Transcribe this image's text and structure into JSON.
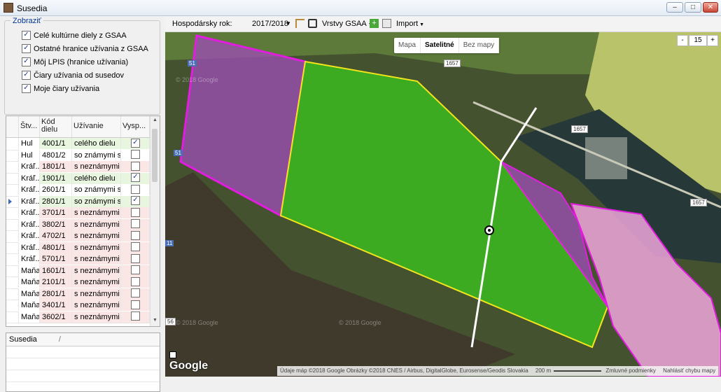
{
  "window": {
    "title": "Susedia"
  },
  "display_group": {
    "title": "Zobraziť",
    "items": [
      {
        "label": "Celé kultúrne diely z GSAA",
        "checked": true
      },
      {
        "label": "Ostatné hranice užívania z GSAA",
        "checked": true
      },
      {
        "label": "Môj LPIS (hranice užívania)",
        "checked": true
      },
      {
        "label": "Čiary užívania od susedov",
        "checked": true
      },
      {
        "label": "Moje čiary užívania",
        "checked": true
      }
    ]
  },
  "grid": {
    "headers": [
      "Štv...",
      "Kód dielu",
      "Užívanie",
      "Vysp..."
    ],
    "rows": [
      {
        "stv": "Hul",
        "kod": "4001/1",
        "uzivanie": "celého dielu",
        "checked": true,
        "tint": "green"
      },
      {
        "stv": "Hul",
        "kod": "4801/2",
        "uzivanie": "so známymi s...",
        "checked": false,
        "tint": "none"
      },
      {
        "stv": "Kráľ...",
        "kod": "1801/1",
        "uzivanie": "s neznámymi ...",
        "checked": false,
        "tint": "red"
      },
      {
        "stv": "Kráľ...",
        "kod": "1901/1",
        "uzivanie": "celého dielu",
        "checked": true,
        "tint": "green"
      },
      {
        "stv": "Kráľ...",
        "kod": "2601/1",
        "uzivanie": "so známymi s...",
        "checked": false,
        "tint": "none"
      },
      {
        "stv": "Kráľ...",
        "kod": "2801/1",
        "uzivanie": "so známymi s...",
        "checked": true,
        "tint": "green",
        "selected": true
      },
      {
        "stv": "Kráľ...",
        "kod": "3701/1",
        "uzivanie": "s neznámymi ...",
        "checked": false,
        "tint": "red"
      },
      {
        "stv": "Kráľ...",
        "kod": "3802/1",
        "uzivanie": "s neznámymi ...",
        "checked": false,
        "tint": "red"
      },
      {
        "stv": "Kráľ...",
        "kod": "4702/1",
        "uzivanie": "s neznámymi ...",
        "checked": false,
        "tint": "red"
      },
      {
        "stv": "Kráľ...",
        "kod": "4801/1",
        "uzivanie": "s neznámymi ...",
        "checked": false,
        "tint": "red"
      },
      {
        "stv": "Kráľ...",
        "kod": "5701/1",
        "uzivanie": "s neznámymi ...",
        "checked": false,
        "tint": "red"
      },
      {
        "stv": "Maňa",
        "kod": "1601/1",
        "uzivanie": "s neznámymi ...",
        "checked": false,
        "tint": "red"
      },
      {
        "stv": "Maňa",
        "kod": "2101/1",
        "uzivanie": "s neznámymi ...",
        "checked": false,
        "tint": "red"
      },
      {
        "stv": "Maňa",
        "kod": "2801/1",
        "uzivanie": "s neznámymi ...",
        "checked": false,
        "tint": "red"
      },
      {
        "stv": "Maňa",
        "kod": "3401/1",
        "uzivanie": "s neznámymi ...",
        "checked": false,
        "tint": "red"
      },
      {
        "stv": "Maňa",
        "kod": "3602/1",
        "uzivanie": "s neznámymi ...",
        "checked": false,
        "tint": "red"
      }
    ]
  },
  "susedia": {
    "header": "Susedia",
    "sort_mark": "/"
  },
  "toolbar": {
    "year_label": "Hospodársky rok:",
    "year_value": "2017/2018",
    "layers_label": "Vrstvy GSAA",
    "import_label": "Import"
  },
  "map": {
    "types": [
      "Mapa",
      "Satelitné",
      "Bez mapy"
    ],
    "active_type": "Satelitné",
    "zoom_minus": "-",
    "zoom_level": "15",
    "zoom_plus": "+",
    "logo": "Google",
    "attribution": "Údaje máp ©2018 Google Obrázky ©2018 CNES / Airbus, DigitalGlobe, Eurosense/Geodis Slovakia",
    "scale": "200 m",
    "terms": "Zmluvné podmienky",
    "report": "Nahlásiť chybu mapy",
    "road_labels": [
      "1657",
      "1657",
      "1657",
      "51",
      "51",
      "11",
      "56"
    ],
    "watermarks": [
      "© 2018 Google",
      "© 2018 Google",
      "© 2018 Google"
    ],
    "colors": {
      "green_parcel": "#3cb521",
      "purple_parcel": "#9a4fb0",
      "pink_parcel": "#f0a6dc",
      "boundary_yellow": "#f2e51b",
      "boundary_magenta": "#e21ce0"
    }
  }
}
